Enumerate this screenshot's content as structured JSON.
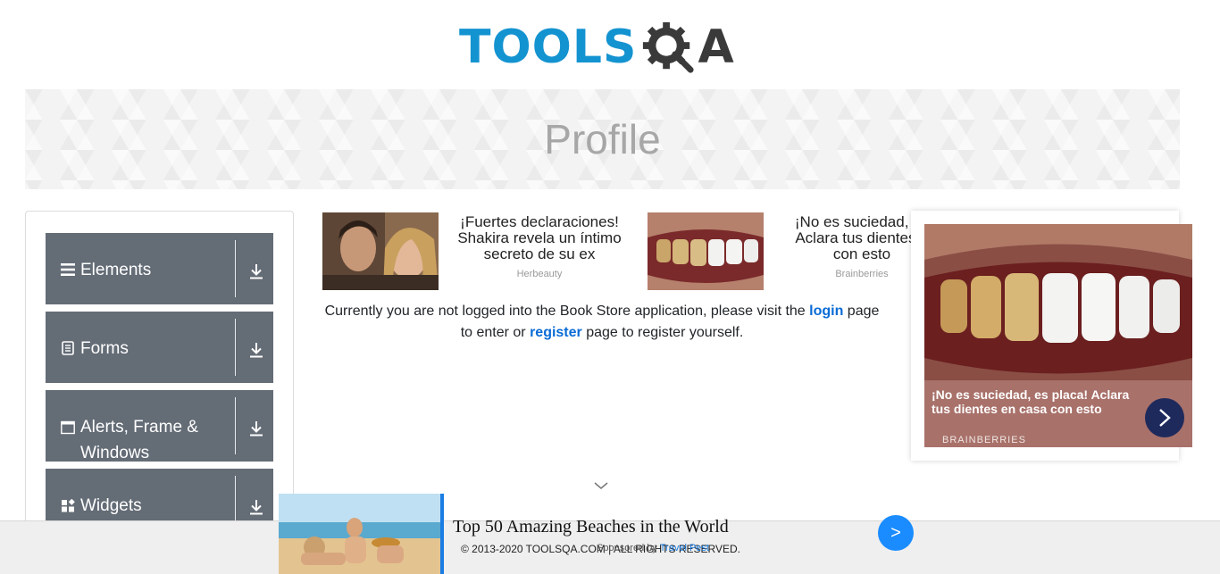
{
  "header": {
    "logo_main": "TOOLS",
    "logo_end": "A",
    "logo_text": "TOOLSQA"
  },
  "banner": {
    "title": "Profile"
  },
  "sidebar": {
    "groups": [
      {
        "label": "Elements",
        "icon": "list-icon"
      },
      {
        "label": "Forms",
        "icon": "form-icon"
      },
      {
        "label": "Alerts, Frame & Windows",
        "icon": "window-icon"
      },
      {
        "label": "Widgets",
        "icon": "widgets-icon"
      }
    ]
  },
  "ads": [
    {
      "title_lines": [
        "¡Fuertes declaraciones!",
        "Shakira revela un íntimo",
        "secreto de su ex"
      ],
      "source": "Herbeauty"
    },
    {
      "title_lines": [
        "¡No es suciedad, es",
        "Aclara tus dientes e",
        "con esto"
      ],
      "source": "Brainberries"
    }
  ],
  "notice": {
    "part1": "Currently you are not logged into the Book Store application, please visit the ",
    "login": "login",
    "part2": " page",
    "part3": "to enter or ",
    "register": "register",
    "part4": " page to register yourself."
  },
  "float_ad": {
    "caption": "¡No es suciedad, es placa! Aclara tus dientes en casa con esto",
    "source": "BRAINBERRIES"
  },
  "bottom_ad": {
    "title": "Top 50 Amazing Beaches in the World",
    "sponsor_prefix": "Sponsored by ",
    "sponsor_name": "Travel Pest",
    "button": ">"
  },
  "footer": {
    "text": "© 2013-2020 TOOLSQA.COM | ALL RIGHTS RESERVED."
  },
  "colors": {
    "brand_blue": "#1493d1",
    "group_bg": "#646c76",
    "link": "#0a6cd6"
  }
}
